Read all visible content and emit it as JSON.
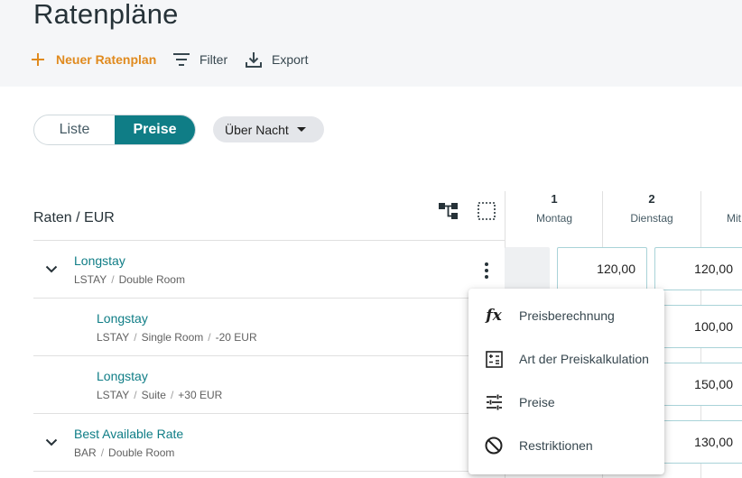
{
  "page": {
    "title": "Ratenpläne"
  },
  "toolbar": {
    "new_label": "Neuer Ratenplan",
    "filter_label": "Filter",
    "export_label": "Export"
  },
  "view_toggle": {
    "options": [
      "Liste",
      "Preise"
    ],
    "selected": "Preise"
  },
  "period_chip": {
    "label": "Über Nacht"
  },
  "grid": {
    "rates_header": "Raten / EUR",
    "days": [
      {
        "num": "1",
        "name": "Montag"
      },
      {
        "num": "2",
        "name": "Dienstag"
      },
      {
        "num": "",
        "name": "Mit"
      }
    ]
  },
  "rates": [
    {
      "name": "Longstay",
      "code": "LSTAY",
      "room": "Double Room",
      "modifier": "",
      "prices": [
        "",
        "120,00",
        "120,00"
      ]
    },
    {
      "name": "Longstay",
      "code": "LSTAY",
      "room": "Single Room",
      "modifier": "-20 EUR",
      "prices": [
        "100,00"
      ]
    },
    {
      "name": "Longstay",
      "code": "LSTAY",
      "room": "Suite",
      "modifier": "+30 EUR",
      "prices": [
        "150,00"
      ]
    },
    {
      "name": "Best Available Rate",
      "code": "BAR",
      "room": "Double Room",
      "modifier": "",
      "prices": [
        "130,00"
      ]
    }
  ],
  "context_menu": {
    "items": [
      {
        "label": "Preisberechnung",
        "icon": "function-icon"
      },
      {
        "label": "Art der Preiskalkulation",
        "icon": "calculator-icon"
      },
      {
        "label": "Preise",
        "icon": "tune-icon"
      },
      {
        "label": "Restriktionen",
        "icon": "block-icon"
      }
    ]
  },
  "colors": {
    "accent": "#0f7d86",
    "new_button": "#e08a1e",
    "topbar": "#f5f6f8",
    "cell_border": "#a9d3d8"
  }
}
